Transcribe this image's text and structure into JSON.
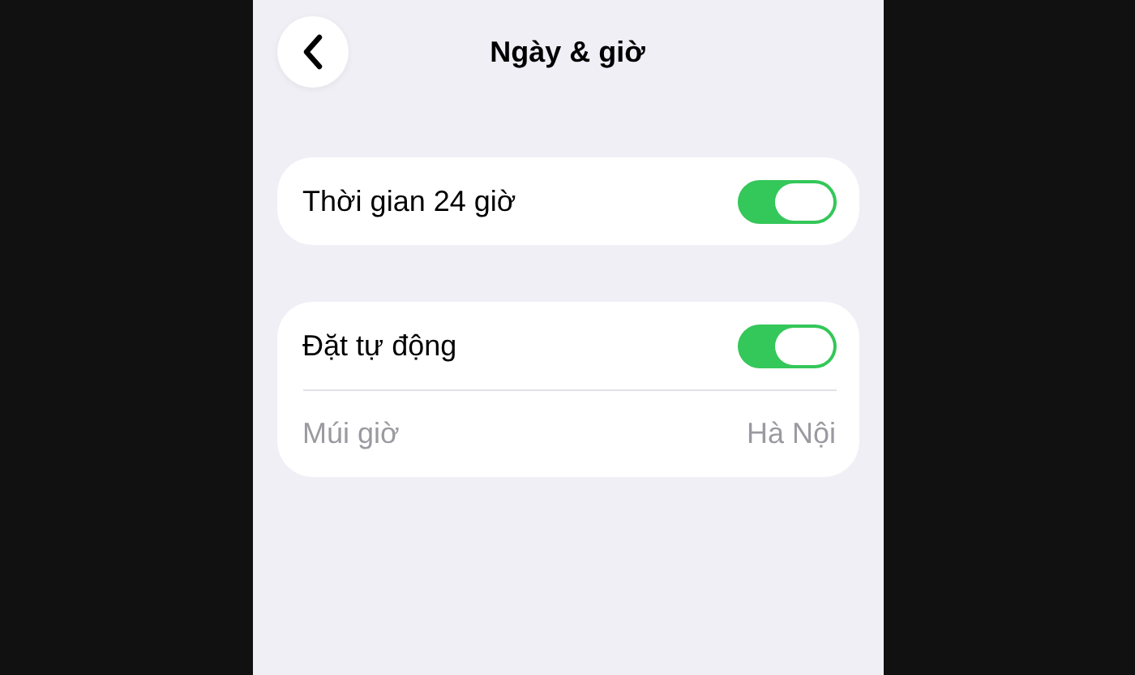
{
  "header": {
    "title": "Ngày & giờ"
  },
  "groups": [
    {
      "rows": [
        {
          "kind": "toggle",
          "label": "Thời gian 24 giờ",
          "on": true,
          "disabled": false
        }
      ]
    },
    {
      "rows": [
        {
          "kind": "toggle",
          "label": "Đặt tự động",
          "on": true,
          "disabled": false
        },
        {
          "kind": "value",
          "label": "Múi giờ",
          "value": "Hà Nội",
          "disabled": true
        }
      ]
    }
  ]
}
